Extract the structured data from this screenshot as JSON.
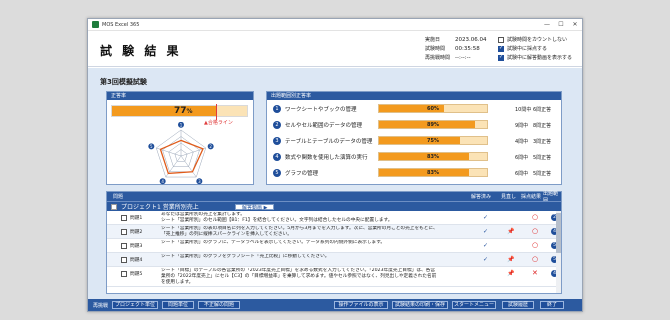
{
  "window": {
    "title": "MOS Excel 365",
    "controls": [
      "—",
      "☐",
      "✕"
    ]
  },
  "header": {
    "title": "試 験 結 果",
    "meta": [
      {
        "label": "実施日",
        "value": "2023.06.04"
      },
      {
        "label": "試験時間",
        "value": "00:35:58"
      },
      {
        "label": "再挑戦時間",
        "value": "--:--:--"
      }
    ],
    "options": [
      {
        "label": "試験時間をカウントしない",
        "checked": false
      },
      {
        "label": "試験中に採点する",
        "checked": true
      },
      {
        "label": "試験中に解答動画を表示する",
        "checked": true
      }
    ]
  },
  "exam_title": "第3回模擬試験",
  "accuracy": {
    "header": "正答率",
    "value_label": "77",
    "unit": "%",
    "value": 0.77,
    "pass_line": 0.7,
    "pass_label": "▲合格ライン"
  },
  "categories": {
    "header": "出題範囲別正答率",
    "items": [
      {
        "num": "1",
        "name": "ワークシートやブックの管理",
        "pct_label": "60%",
        "pct": 0.6,
        "questions": "10問中",
        "correct": "6問正答"
      },
      {
        "num": "2",
        "name": "セルやセル範囲のデータの管理",
        "pct_label": "89%",
        "pct": 0.89,
        "questions": "9問中",
        "correct": "8問正答"
      },
      {
        "num": "3",
        "name": "テーブルとテーブルのデータの管理",
        "pct_label": "75%",
        "pct": 0.75,
        "questions": "4問中",
        "correct": "3問正答"
      },
      {
        "num": "4",
        "name": "数式や関数を使用した演算の実行",
        "pct_label": "83%",
        "pct": 0.83,
        "questions": "6問中",
        "correct": "5問正答"
      },
      {
        "num": "5",
        "name": "グラフの管理",
        "pct_label": "83%",
        "pct": 0.83,
        "questions": "6問中",
        "correct": "5問正答"
      }
    ]
  },
  "radar": {
    "labels": [
      "1",
      "2",
      "3",
      "4",
      "5"
    ],
    "values": [
      0.6,
      0.89,
      0.75,
      0.83,
      0.83
    ]
  },
  "questions": {
    "columns": {
      "q": "問題",
      "answered": "解答済み",
      "review": "見直し",
      "score": "採点結果",
      "range": "出題範囲"
    },
    "project": {
      "label": "プロジェクト1 営業所別売上",
      "video_button": "解答動画 ▶"
    },
    "rows": [
      {
        "label": "問題1",
        "text": [
          "あなたは営業所別の売上を集計します。",
          "シート「営業所別」のセル範囲【B1：F1】を結合してください。文字列は結合したセルの中央に配置します。"
        ],
        "answered": "✓",
        "review": "",
        "score": "○",
        "range": "2"
      },
      {
        "label": "問題2",
        "text": [
          "シート「営業所別」の表の項目名に列を入力してください。5月から3月までを入力します。次に、営業所の月ごとの売上をもとに、",
          "「売上推移」の列に縦棒スパークラインを挿入してください。"
        ],
        "answered": "✓",
        "review": "📌",
        "score": "○",
        "range": "4"
      },
      {
        "label": "問題3",
        "text": [
          "シート「営業所別」のグラフに、データラベルを表示してください。データ系列の内側外側に表示します。"
        ],
        "answered": "✓",
        "review": "",
        "score": "○",
        "range": "5"
      },
      {
        "label": "問題4",
        "text": [
          "シート「営業所別」のグラフをグラフシート「売上比較」に移動してください。"
        ],
        "answered": "✓",
        "review": "📌",
        "score": "○",
        "range": "5"
      },
      {
        "label": "問題5",
        "text": [
          "シート「目標」のテーブルの各営業所の「2023年度売上目標」を求める数式を入力してください。「2023年度売上目標」は、各営",
          "業所の「2022年度売上」にセル【C3】の「目標増益率」を乗算して求めます。値やセル参照ではなく、列見出しや定義された名前",
          "を使用します。"
        ],
        "answered": "",
        "review": "📌",
        "score": "✕",
        "range": "4"
      }
    ]
  },
  "footer": {
    "label": "再挑戦",
    "buttons": [
      "プロジェクト単位",
      "問題単位",
      "不正解の問題",
      "操作ファイルの表示",
      "試験結果の印刷・保存",
      "スタートメニュー",
      "試験履歴",
      "終了"
    ]
  },
  "colors": {
    "accent": "#2c5aa0",
    "bar": "#f39a1e",
    "bar_bg": "#fbe3b6",
    "error": "#d22222"
  }
}
